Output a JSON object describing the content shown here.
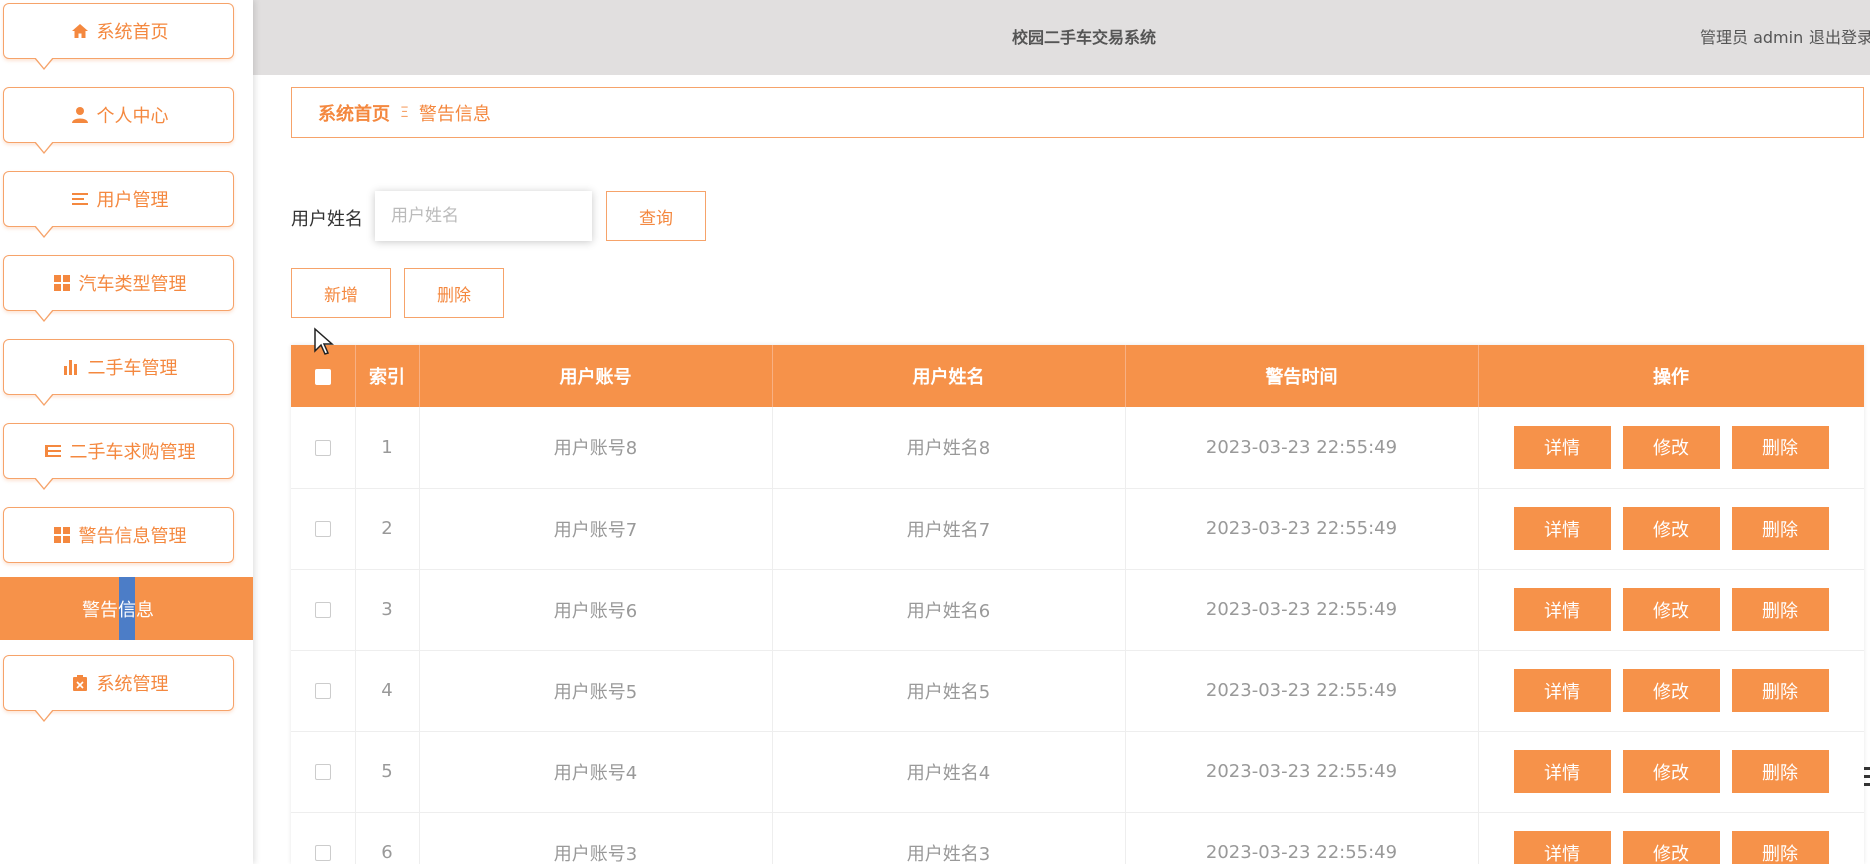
{
  "header": {
    "title": "校园二手车交易系统",
    "user_text": "管理员 admin",
    "logout_label": "退出登录"
  },
  "sidebar": {
    "items": [
      {
        "label": "系统首页",
        "icon": "home-icon"
      },
      {
        "label": "个人中心",
        "icon": "user-icon"
      },
      {
        "label": "用户管理",
        "icon": "list-icon"
      },
      {
        "label": "汽车类型管理",
        "icon": "grid-icon"
      },
      {
        "label": "二手车管理",
        "icon": "bar-chart-icon"
      },
      {
        "label": "二手车求购管理",
        "icon": "list-icon"
      },
      {
        "label": "警告信息管理",
        "icon": "grid-icon"
      },
      {
        "label": "系统管理",
        "icon": "clipboard-icon"
      }
    ],
    "active_submenu": {
      "label": "警告信息"
    }
  },
  "breadcrumb": {
    "home": "系统首页",
    "separator": "Ξ",
    "current": "警告信息"
  },
  "search": {
    "label": "用户姓名",
    "placeholder": "用户姓名",
    "value": "",
    "query_button": "查询"
  },
  "actions": {
    "add_label": "新增",
    "delete_label": "删除"
  },
  "table": {
    "columns": [
      "索引",
      "用户账号",
      "用户姓名",
      "警告时间",
      "操作"
    ],
    "op_labels": {
      "detail": "详情",
      "edit": "修改",
      "delete": "删除"
    },
    "rows": [
      {
        "index": "1",
        "account": "用户账号8",
        "name": "用户姓名8",
        "time": "2023-03-23 22:55:49"
      },
      {
        "index": "2",
        "account": "用户账号7",
        "name": "用户姓名7",
        "time": "2023-03-23 22:55:49"
      },
      {
        "index": "3",
        "account": "用户账号6",
        "name": "用户姓名6",
        "time": "2023-03-23 22:55:49"
      },
      {
        "index": "4",
        "account": "用户账号5",
        "name": "用户姓名5",
        "time": "2023-03-23 22:55:49"
      },
      {
        "index": "5",
        "account": "用户账号4",
        "name": "用户姓名4",
        "time": "2023-03-23 22:55:49"
      },
      {
        "index": "6",
        "account": "用户账号3",
        "name": "用户姓名3",
        "time": "2023-03-23 22:55:49"
      }
    ]
  },
  "colors": {
    "accent": "#f6924a",
    "accent_text": "#f4883f",
    "header_bg": "#e1dfdf"
  }
}
